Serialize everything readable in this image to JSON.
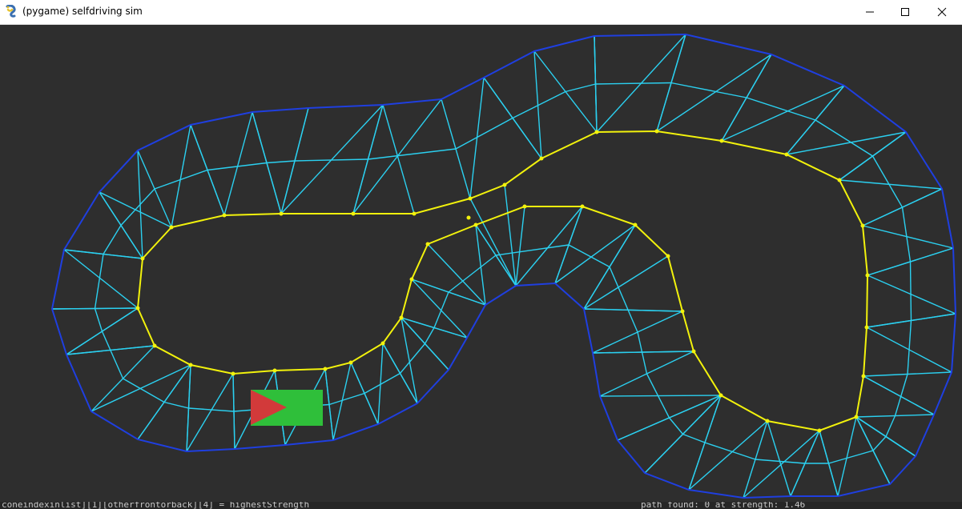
{
  "window": {
    "title": "(pygame) selfdriving sim",
    "minimize_icon": "minimize-icon",
    "maximize_icon": "maximize-icon",
    "close_icon": "close-icon"
  },
  "colors": {
    "background": "#2e2e2e",
    "outer_border": "#1f3fe0",
    "inner_border": "#f2f20c",
    "track_mesh": "#2bd0f0",
    "vertex": "#f2f20c",
    "car_body": "#2fbf3a",
    "car_arrow": "#d23a3a"
  },
  "console": {
    "left_text": "coneindexinlist][1][otherfrontorback][4] = highestStrength",
    "right_text": "path found: 0 at strength: 1.46"
  }
}
